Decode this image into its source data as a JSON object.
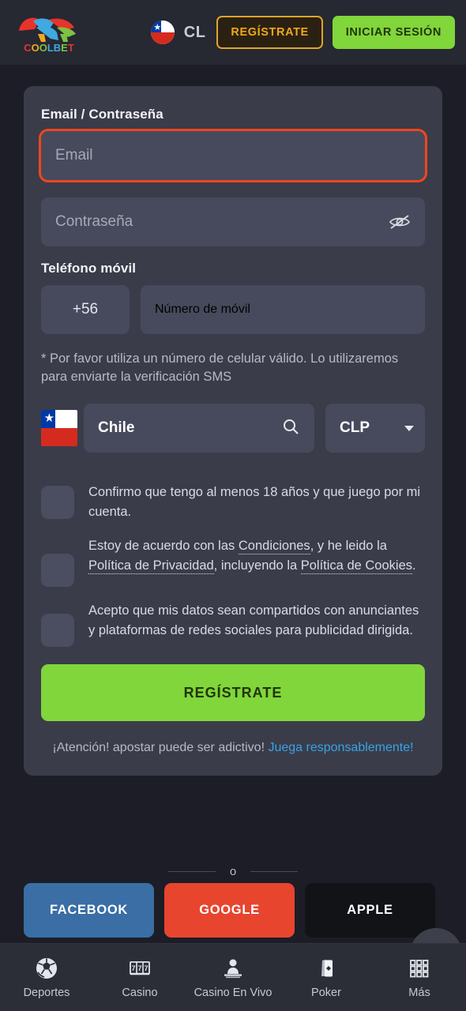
{
  "header": {
    "logo_text": "COOLBET",
    "country_code": "CL",
    "register_label": "REGÍSTRATE",
    "login_label": "INICIAR SESIÓN",
    "flag_name": "chile-flag",
    "accent_yellow": "#f0a818",
    "accent_green": "#80d63a"
  },
  "form": {
    "email_password_label": "Email / Contraseña",
    "email_placeholder": "Email",
    "email_value": "",
    "email_has_error": true,
    "error_color": "#f2451e",
    "password_placeholder": "Contraseña",
    "password_value": "",
    "phone_label": "Teléfono móvil",
    "phone_prefix": "+56",
    "phone_placeholder": "Número de móvil",
    "phone_value": "",
    "sms_hint": "* Por favor utiliza un número de celular válido. Lo utilizaremos para enviarte la verificación SMS",
    "country_value": "Chile",
    "currency_value": "CLP",
    "submit_label": "REGÍSTRATE"
  },
  "terms": [
    {
      "id": "age-confirmation",
      "checked": false,
      "parts": [
        {
          "text": "Confirmo que tengo al menos 18 años y que juego por mi cuenta.",
          "link": false
        }
      ]
    },
    {
      "id": "terms-privacy",
      "checked": false,
      "parts": [
        {
          "text": "Estoy de acuerdo con las ",
          "link": false
        },
        {
          "text": "Condiciones",
          "link": true
        },
        {
          "text": ", y he leido la ",
          "link": false
        },
        {
          "text": "Política de Privacidad",
          "link": true
        },
        {
          "text": ", incluyendo la ",
          "link": false
        },
        {
          "text": "Política de Cookies",
          "link": true
        },
        {
          "text": ".",
          "link": false
        }
      ]
    },
    {
      "id": "marketing-consent",
      "checked": false,
      "parts": [
        {
          "text": "Acepto que mis datos sean compartidos con anunciantes y plataformas de redes sociales para publicidad dirigida.",
          "link": false
        }
      ]
    }
  ],
  "warning": {
    "text": "¡Atención! apostar puede ser adictivo! ",
    "link_text": "Juega responsablemente!",
    "link_color": "#37a3e8"
  },
  "divider": {
    "label": "o"
  },
  "social": [
    {
      "label": "FACEBOOK",
      "color": "#3a6ea5",
      "key": "fb"
    },
    {
      "label": "GOOGLE",
      "color": "#e8452f",
      "key": "gg"
    },
    {
      "label": "APPLE",
      "color": "#121317",
      "key": "ap"
    }
  ],
  "help": {
    "icon": "chat-question-icon"
  },
  "bottom_nav": [
    {
      "label": "Deportes",
      "icon": "soccer-ball-icon"
    },
    {
      "label": "Casino",
      "icon": "slot-machine-icon"
    },
    {
      "label": "Casino En Vivo",
      "icon": "live-dealer-icon"
    },
    {
      "label": "Poker",
      "icon": "playing-cards-icon"
    },
    {
      "label": "Más",
      "icon": "grid-menu-icon"
    }
  ]
}
